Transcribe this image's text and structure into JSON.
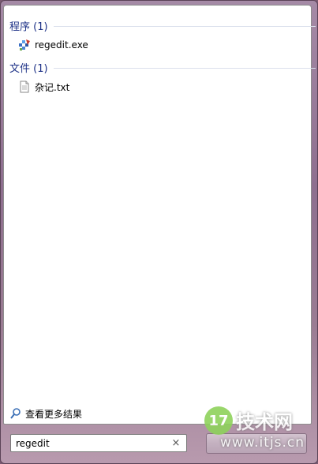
{
  "results": {
    "programs": {
      "header": "程序 (1)",
      "items": [
        {
          "label": "regedit.exe",
          "icon": "regedit-icon"
        }
      ]
    },
    "files": {
      "header": "文件 (1)",
      "items": [
        {
          "label": "杂记.txt",
          "icon": "text-file-icon"
        }
      ]
    }
  },
  "see_more": {
    "label": "查看更多结果",
    "icon": "search-icon"
  },
  "search": {
    "value": "regedit",
    "clear_icon": "close-icon"
  },
  "watermark": {
    "logo_text": "17",
    "brand": "技术网",
    "url": "www.itjs.cn"
  },
  "colors": {
    "header_text": "#1e3287",
    "frame": "#9a7c93",
    "watermark_green": "#8ed25c"
  }
}
